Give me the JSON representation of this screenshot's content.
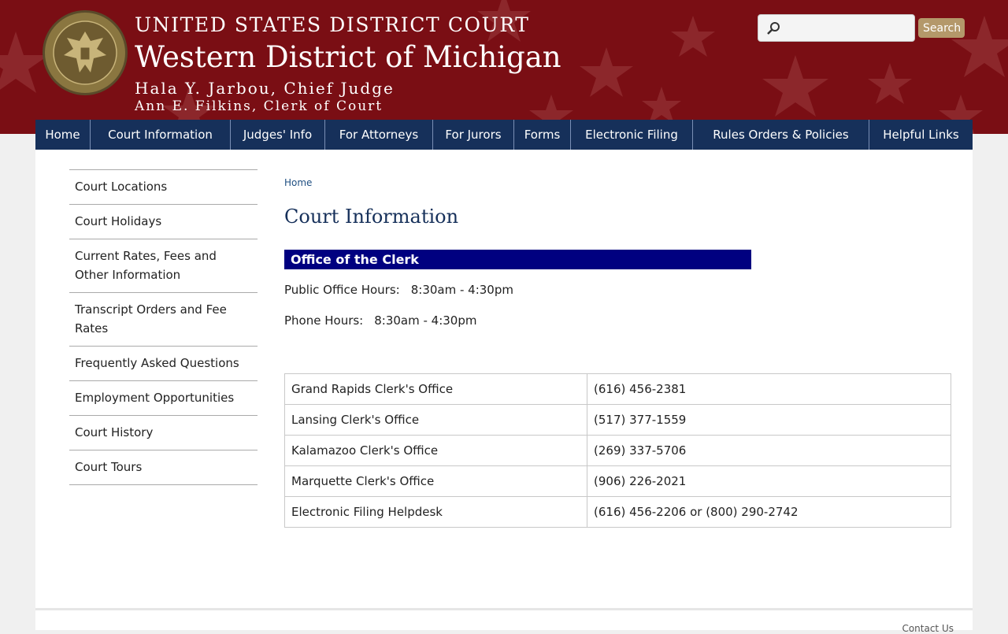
{
  "header": {
    "line1": "UNITED STATES DISTRICT COURT",
    "line2": "Western District of Michigan",
    "line3": "Hala Y. Jarbou, Chief Judge",
    "line4": "Ann E. Filkins, Clerk of Court",
    "seal_icon": "court-seal-icon",
    "colors": {
      "background": "#7a0e14",
      "search_button": "#b4986a"
    }
  },
  "search": {
    "placeholder": "",
    "button_label": "Search"
  },
  "nav": {
    "items": [
      "Home",
      "Court Information",
      "Judges' Info",
      "For Attorneys",
      "For Jurors",
      "Forms",
      "Electronic Filing",
      "Rules Orders & Policies",
      "Helpful Links"
    ],
    "color": "#16305a"
  },
  "sidebar": {
    "items": [
      "Court Locations",
      "Court Holidays",
      "Current Rates, Fees and Other Information",
      "Transcript Orders and Fee Rates",
      "Frequently Asked Questions",
      "Employment Opportunities",
      "Court History",
      "Court Tours"
    ]
  },
  "main": {
    "breadcrumb": "Home",
    "title": "Court Information",
    "section_heading": "Office of the Clerk",
    "public_hours_label": "Public Office Hours:",
    "public_hours_value": "8:30am - 4:30pm",
    "phone_hours_label": "Phone Hours:",
    "phone_hours_value": "8:30am - 4:30pm",
    "offices": [
      {
        "name": "Grand Rapids Clerk's Office",
        "phone": "(616) 456-2381"
      },
      {
        "name": "Lansing Clerk's Office",
        "phone": "(517) 377-1559"
      },
      {
        "name": "Kalamazoo Clerk's Office",
        "phone": "(269) 337-5706"
      },
      {
        "name": "Marquette Clerk's Office",
        "phone": "(906) 226-2021"
      },
      {
        "name": "Electronic Filing Helpdesk",
        "phone": "(616) 456-2206 or (800) 290-2742"
      }
    ]
  },
  "footer": {
    "contact_link": "Contact Us"
  }
}
